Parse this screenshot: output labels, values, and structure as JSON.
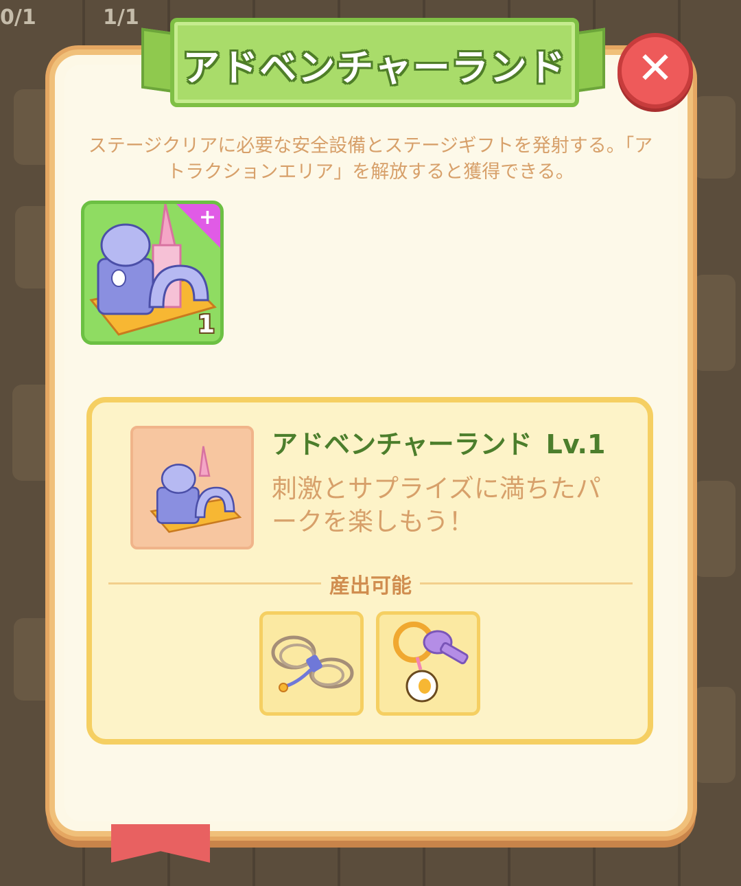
{
  "window": {
    "title": "アドベンチャーランド"
  },
  "background": {
    "counter_left": "0/1",
    "counter_mid": "1/1"
  },
  "dialog": {
    "close_icon": "close-icon",
    "description": "ステージクリアに必要な安全設備とステージギフトを発射する。「アトラクションエリア」を解放すると獲得できる。",
    "item": {
      "icon": "bouncy-castle-icon",
      "count": "1",
      "badge_icon": "plus-icon"
    },
    "info": {
      "name": "アドベンチャーランド",
      "level": "Lv.1",
      "tagline": "刺激とサプライズに満ちたパークを楽しもう！",
      "produces_label": "産出可能",
      "produces": [
        {
          "icon": "rope-icon"
        },
        {
          "icon": "keychain-icon"
        }
      ]
    }
  },
  "colors": {
    "ribbon": "#a9dc6a",
    "close": "#ee5a5a",
    "title_green": "#4c7e2c",
    "text_tan": "#d7a06a",
    "panel": "#fdf8e6",
    "info_box": "#fdf3c8",
    "info_border": "#f5cf62"
  }
}
